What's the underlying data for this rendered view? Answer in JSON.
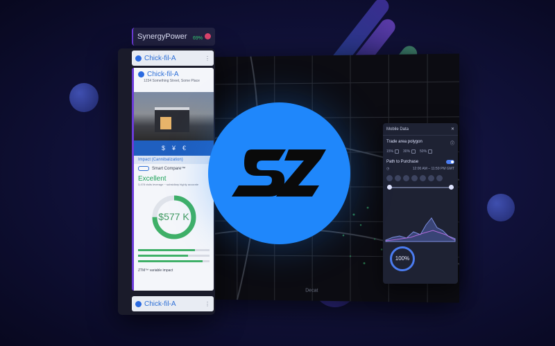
{
  "colors": {
    "background": "#11123c",
    "accent_blue": "#1f87fb",
    "accent_purple": "#6b3bd8",
    "good_green": "#38d27a"
  },
  "brand": {
    "name": "SynergyPower",
    "percent": "69%"
  },
  "places": [
    {
      "name": "Chick-fil-A"
    },
    {
      "name": "Chick-fil-A"
    }
  ],
  "detail": {
    "name": "Chick-fil-A",
    "address": "1234 Something Street, Some Place",
    "actions": [
      "$",
      "¥",
      "€"
    ],
    "impact_label": "Impact (Cannibalization)",
    "smart_compare": "Smart Compare™",
    "rating": "Excellent",
    "rating_note": "3,478 visits leverage ~ subsidiary highly accurate",
    "gauge_value": "577 K",
    "gauge_prefix": "$",
    "gauge_fraction": 0.75,
    "bar_fractions": [
      0.8,
      0.7,
      0.9
    ],
    "bottom_note": "ZTM™ variable impact"
  },
  "mobile_data": {
    "title": "Mobile Data",
    "trade_area": "Trade area polygon",
    "trade_options": [
      "15%",
      "30%",
      "50%"
    ],
    "path_to_purchase": "Path to Purchase",
    "time_range": "12:00 AM – 11:59 PM GMT",
    "donut_value": "100%"
  },
  "map": {
    "label": "Decat"
  },
  "logo": {
    "text": "SZ",
    "icon": "sz-logo-icon"
  }
}
